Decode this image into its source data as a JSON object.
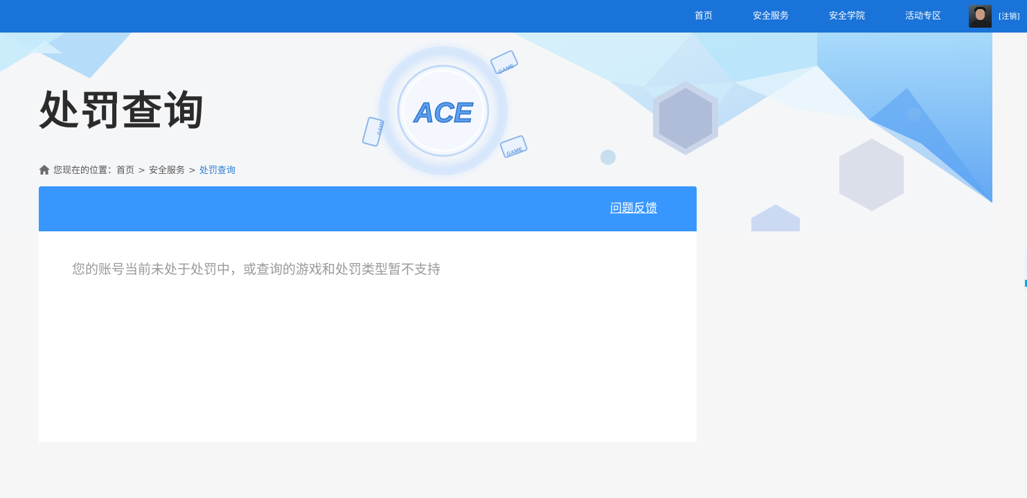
{
  "nav": {
    "home": "首页",
    "security_service": "安全服务",
    "security_academy": "安全学院",
    "activity_zone": "活动专区",
    "logout": "[注销]"
  },
  "banner": {
    "title": "处罚查询",
    "logo_text": "ACE",
    "device_labels": [
      "GAME",
      "GAME",
      "GAME"
    ]
  },
  "breadcrumb": {
    "prefix": "您现在的位置：",
    "items": [
      "首页",
      "安全服务"
    ],
    "separator": ">",
    "current": "处罚查询"
  },
  "panel": {
    "feedback_link": "问题反馈",
    "message": "您的账号当前未处于处罚中，或查询的游戏和处罚类型暂不支持"
  },
  "colors": {
    "topbar": "#1a73d8",
    "panel_header": "#3897ff",
    "current_crumb": "#2a7dd6",
    "message_text": "#999999"
  }
}
